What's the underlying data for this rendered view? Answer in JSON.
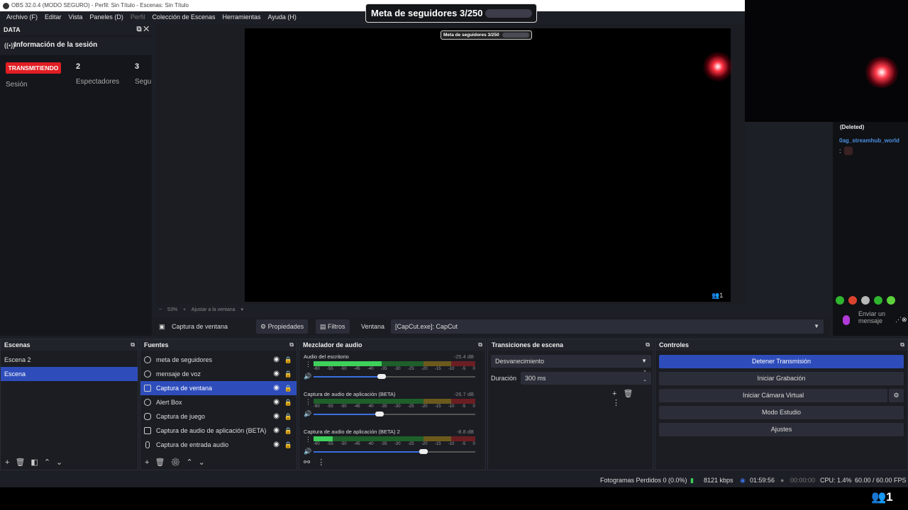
{
  "window_title": "OBS 32.0.4 (MODO SEGURO) - Perfil: Sin Título - Escenas: Sin Título",
  "menu": [
    "Archivo (F)",
    "Editar",
    "Vista",
    "Paneles (D)",
    "Perfil",
    "Colección de Escenas",
    "Herramientas",
    "Ayuda (H)"
  ],
  "data_dock": {
    "title": "DATA",
    "session_title": "Información de la sesión",
    "live_badge": "TRANSMITIENDO",
    "session_label": "Sesión",
    "viewers_value": "2",
    "viewers_label": "Espectadores",
    "followers_value": "3",
    "followers_label": "Segu"
  },
  "overlay": {
    "goal_text": "Meta de seguidores 3/250",
    "goal_text_big": "Meta de seguidores 3/250",
    "canvas_viewers": "1"
  },
  "zoom": {
    "value": "53%",
    "fit": "Ajustar a la ventana"
  },
  "source_toolbar": {
    "source_name": "Captura de ventana",
    "properties": "Propiedades",
    "filters": "Filtros",
    "window_label": "Ventana",
    "window_value": "[CapCut.exe]: CapCut"
  },
  "chat": {
    "deleted": "(Deleted)",
    "username": "0ag_streamhub_world",
    "colon": ":",
    "input_placeholder": "Enviar un mensaje"
  },
  "scenes": {
    "title": "Escenas",
    "items": [
      {
        "name": "Escena 2",
        "selected": false
      },
      {
        "name": "Escena",
        "selected": true
      }
    ]
  },
  "sources": {
    "title": "Fuentes",
    "items": [
      {
        "name": "meta de seguidores",
        "icon": "browser-icon",
        "selected": false
      },
      {
        "name": "mensaje de voz",
        "icon": "browser-icon",
        "selected": false
      },
      {
        "name": "Captura de ventana",
        "icon": "window-capture-icon",
        "selected": true
      },
      {
        "name": "Alert Box",
        "icon": "browser-icon",
        "selected": false
      },
      {
        "name": "Captura de juego",
        "icon": "gamepad-icon",
        "selected": false
      },
      {
        "name": "Captura de audio de aplicación (BETA)",
        "icon": "app-audio-icon",
        "selected": false
      },
      {
        "name": "Captura de entrada audio",
        "icon": "microphone-icon",
        "selected": false
      }
    ]
  },
  "mixer": {
    "title": "Mezclador de audio",
    "scale": [
      "-60",
      "-55",
      "-50",
      "-45",
      "-40",
      "-35",
      "-30",
      "-25",
      "-20",
      "-15",
      "-10",
      "-5",
      "0"
    ],
    "channels": [
      {
        "name": "Audio del escritorio",
        "db": "-25.4 dB",
        "level": 0.42,
        "volume": 0.42
      },
      {
        "name": "Captura de audio de aplicación (BETA)",
        "db": "-26.7 dB",
        "level": 0.0,
        "volume": 0.41
      },
      {
        "name": "Captura de audio de aplicación (BETA) 2",
        "db": "-8.8 dB",
        "level": 0.12,
        "volume": 0.68
      }
    ]
  },
  "transitions": {
    "title": "Transiciones de escena",
    "selected": "Desvanecimiento",
    "duration_label": "Duración",
    "duration_value": "300 ms"
  },
  "controls": {
    "title": "Controles",
    "stop_stream": "Detener Transmisión",
    "start_recording": "Iniciar Grabación",
    "virtual_cam": "Iniciar Cámara Virtual",
    "studio_mode": "Modo Estudio",
    "settings": "Ajustes"
  },
  "status": {
    "dropped_frames": "Fotogramas Perdidos 0 (0.0%)",
    "bitrate": "8121 kbps",
    "stream_time": "01:59:56",
    "rec_time": "00:00:00",
    "cpu": "CPU: 1.4%",
    "fps": "60.00 / 60.00 FPS",
    "viewers": "1"
  },
  "colors": {
    "accent": "#2e4dbb",
    "live": "#e01e23",
    "chat_user": "#4a8fe0"
  }
}
